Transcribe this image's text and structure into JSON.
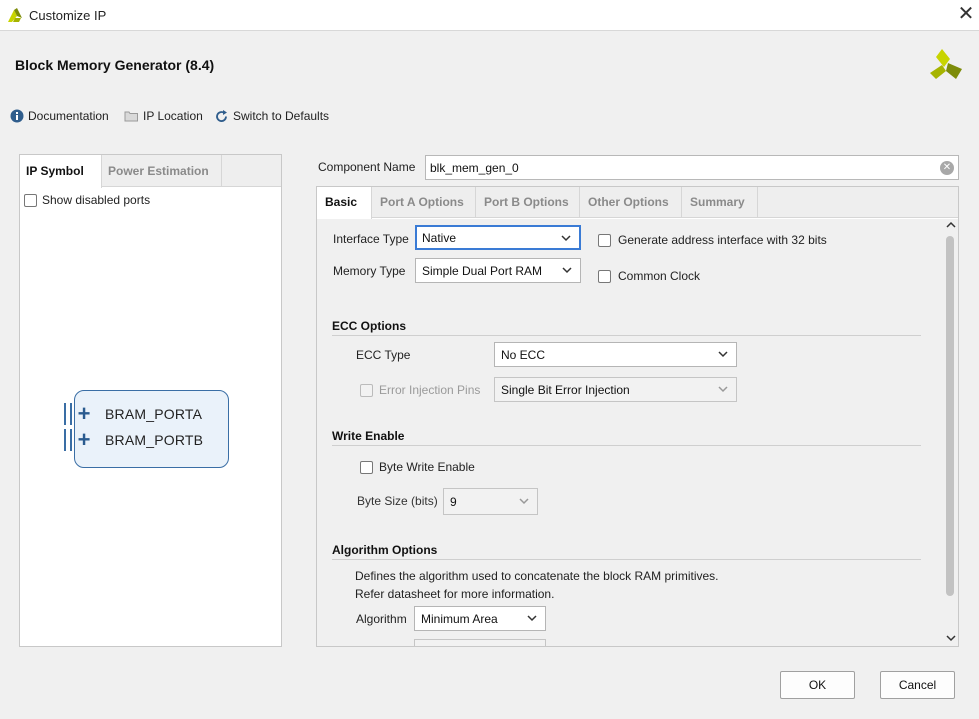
{
  "window": {
    "title": "Customize IP",
    "close_glyph": "✕"
  },
  "header": {
    "title": "Block Memory Generator (8.4)"
  },
  "toolbar": {
    "documentation": "Documentation",
    "ip_location": "IP Location",
    "switch_defaults": "Switch to Defaults"
  },
  "left_panel": {
    "tabs": [
      "IP Symbol",
      "Power Estimation"
    ],
    "show_disabled_ports": "Show disabled ports",
    "ports": [
      "BRAM_PORTA",
      "BRAM_PORTB"
    ]
  },
  "component": {
    "label": "Component Name",
    "value": "blk_mem_gen_0"
  },
  "tabs": [
    "Basic",
    "Port A Options",
    "Port B Options",
    "Other Options",
    "Summary"
  ],
  "basic": {
    "interface_type_label": "Interface Type",
    "interface_type_value": "Native",
    "memory_type_label": "Memory Type",
    "memory_type_value": "Simple Dual Port RAM",
    "gen_address_interface": "Generate address interface with 32 bits",
    "common_clock": "Common Clock",
    "ecc": {
      "title": "ECC Options",
      "type_label": "ECC Type",
      "type_value": "No ECC",
      "error_injection_label": "Error Injection Pins",
      "error_injection_value": "Single Bit Error Injection"
    },
    "write_enable": {
      "title": "Write Enable",
      "byte_write_enable": "Byte Write Enable",
      "byte_size_label": "Byte Size (bits)",
      "byte_size_value": "9"
    },
    "algorithm": {
      "title": "Algorithm Options",
      "desc_line1": "Defines the algorithm used to concatenate the block RAM primitives.",
      "desc_line2": "Refer datasheet for more information.",
      "algorithm_label": "Algorithm",
      "algorithm_value": "Minimum Area"
    }
  },
  "buttons": {
    "ok": "OK",
    "cancel": "Cancel"
  },
  "colors": {
    "accent": "#3a7bd5",
    "symbol_border": "#3a6ea5",
    "logo_yellow": "#c8d400",
    "logo_olive": "#7d8c0a"
  }
}
